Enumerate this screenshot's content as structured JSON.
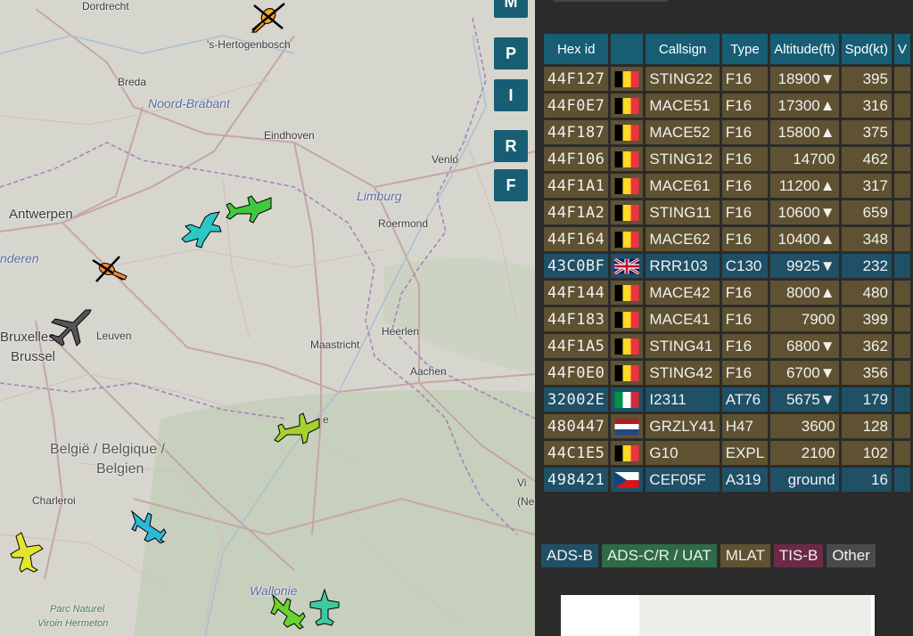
{
  "map": {
    "places": [
      {
        "name": "Dordrecht"
      },
      {
        "name": "'s-Hertogenbosch"
      },
      {
        "name": "Breda"
      },
      {
        "name": "Noord-Brabant"
      },
      {
        "name": "Eindhoven"
      },
      {
        "name": "Venlo"
      },
      {
        "name": "Limburg"
      },
      {
        "name": "Roermond"
      },
      {
        "name": "Antwerpen"
      },
      {
        "name": "nderen"
      },
      {
        "name": "Leuven"
      },
      {
        "name": "Bruxelles"
      },
      {
        "name": "Brussel"
      },
      {
        "name": "Heerlen"
      },
      {
        "name": "Maastricht"
      },
      {
        "name": "Aachen"
      },
      {
        "name": "België / Belgique /"
      },
      {
        "name": "Belgien"
      },
      {
        "name": "Charleroi"
      },
      {
        "name": "Wallonie"
      },
      {
        "name": "Parc Naturel"
      },
      {
        "name": "Viroin Hermeton"
      },
      {
        "name": "e"
      },
      {
        "name": "Vi"
      },
      {
        "name": "(Ne"
      }
    ],
    "aircraft_icons": [
      {
        "kind": "helicopter",
        "color": "#f5a623"
      },
      {
        "kind": "fighter",
        "color": "#3ec93e"
      },
      {
        "kind": "fighter",
        "color": "#2ec7c7"
      },
      {
        "kind": "helicopter",
        "color": "#f58a2e"
      },
      {
        "kind": "airliner",
        "color": "#555555"
      },
      {
        "kind": "fighter",
        "color": "#a6d22e"
      },
      {
        "kind": "fighter",
        "color": "#2eb7d8"
      },
      {
        "kind": "fighter",
        "color": "#e5e52e"
      },
      {
        "kind": "fighter",
        "color": "#6ad22e"
      },
      {
        "kind": "fighter",
        "color": "#3ec9a0"
      }
    ]
  },
  "buttons": [
    "M",
    "P",
    "I",
    "R",
    "F"
  ],
  "table": {
    "headers": [
      "Hex id",
      "",
      "Callsign",
      "Type",
      "Altitude(ft)",
      "Spd(kt)",
      "V"
    ],
    "rows": [
      {
        "hex": "44F127",
        "flag": "be",
        "callsign": "STING22",
        "type": "F16",
        "alt": "18900▼",
        "spd": "395",
        "src": "mlat"
      },
      {
        "hex": "44F0E7",
        "flag": "be",
        "callsign": "MACE51",
        "type": "F16",
        "alt": "17300▲",
        "spd": "316",
        "src": "mlat"
      },
      {
        "hex": "44F187",
        "flag": "be",
        "callsign": "MACE52",
        "type": "F16",
        "alt": "15800▲",
        "spd": "375",
        "src": "mlat"
      },
      {
        "hex": "44F106",
        "flag": "be",
        "callsign": "STING12",
        "type": "F16",
        "alt": "14700",
        "spd": "462",
        "src": "mlat"
      },
      {
        "hex": "44F1A1",
        "flag": "be",
        "callsign": "MACE61",
        "type": "F16",
        "alt": "11200▲",
        "spd": "317",
        "src": "mlat"
      },
      {
        "hex": "44F1A2",
        "flag": "be",
        "callsign": "STING11",
        "type": "F16",
        "alt": "10600▼",
        "spd": "659",
        "src": "mlat"
      },
      {
        "hex": "44F164",
        "flag": "be",
        "callsign": "MACE62",
        "type": "F16",
        "alt": "10400▲",
        "spd": "348",
        "src": "mlat"
      },
      {
        "hex": "43C0BF",
        "flag": "gb",
        "callsign": "RRR103",
        "type": "C130",
        "alt": "9925▼",
        "spd": "232",
        "src": "adsb"
      },
      {
        "hex": "44F144",
        "flag": "be",
        "callsign": "MACE42",
        "type": "F16",
        "alt": "8000▲",
        "spd": "480",
        "src": "mlat"
      },
      {
        "hex": "44F183",
        "flag": "be",
        "callsign": "MACE41",
        "type": "F16",
        "alt": "7900",
        "spd": "399",
        "src": "mlat"
      },
      {
        "hex": "44F1A5",
        "flag": "be",
        "callsign": "STING41",
        "type": "F16",
        "alt": "6800▼",
        "spd": "362",
        "src": "mlat"
      },
      {
        "hex": "44F0E0",
        "flag": "be",
        "callsign": "STING42",
        "type": "F16",
        "alt": "6700▼",
        "spd": "356",
        "src": "mlat"
      },
      {
        "hex": "32002E",
        "flag": "it",
        "callsign": "I2311",
        "type": "AT76",
        "alt": "5675▼",
        "spd": "179",
        "src": "adsb"
      },
      {
        "hex": "480447",
        "flag": "nl",
        "callsign": "GRZLY41",
        "type": "H47",
        "alt": "3600",
        "spd": "128",
        "src": "mlat"
      },
      {
        "hex": "44C1E5",
        "flag": "be",
        "callsign": "G10",
        "type": "EXPL",
        "alt": "2100",
        "spd": "102",
        "src": "mlat"
      },
      {
        "hex": "498421",
        "flag": "cz",
        "callsign": "CEF05F",
        "type": "A319",
        "alt": "ground",
        "spd": "16",
        "src": "adsb"
      }
    ]
  },
  "legend": [
    {
      "label": "ADS-B",
      "color": "#1f5066"
    },
    {
      "label": "ADS-C/R / UAT",
      "color": "#2e6b46"
    },
    {
      "label": "MLAT",
      "color": "#5e5232"
    },
    {
      "label": "TIS-B",
      "color": "#6b2a45"
    },
    {
      "label": "Other",
      "color": "#4a4a4a"
    }
  ]
}
